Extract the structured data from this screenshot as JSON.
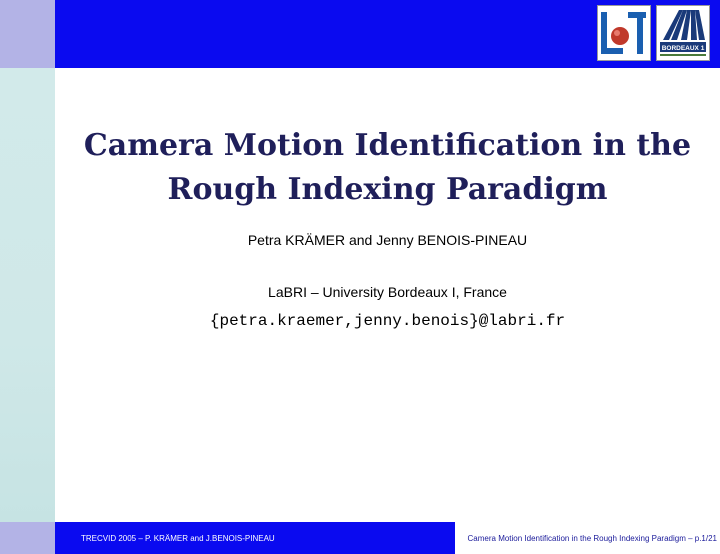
{
  "slide": {
    "title_line1": "Camera Motion Identification in the",
    "title_line2": "Rough Indexing Paradigm",
    "authors": "Petra KRÄMER and Jenny BENOIS-PINEAU",
    "affiliation": "LaBRI – University Bordeaux I, France",
    "email": "{petra.kraemer,jenny.benois}@labri.fr"
  },
  "footer": {
    "left": "TRECVID 2005 – P. KRÄMER and J.BENOIS-PINEAU",
    "right": "Camera Motion Identification in the Rough Indexing Paradigm – p.1/21"
  },
  "logos": {
    "right_logo_text": "BORDEAUX 1"
  },
  "colors": {
    "header_blue": "#0a0af0",
    "corner_lavender": "#b3b3e6",
    "sidebar_teal": "#cfe8e8",
    "title_navy": "#1f1f5a"
  }
}
